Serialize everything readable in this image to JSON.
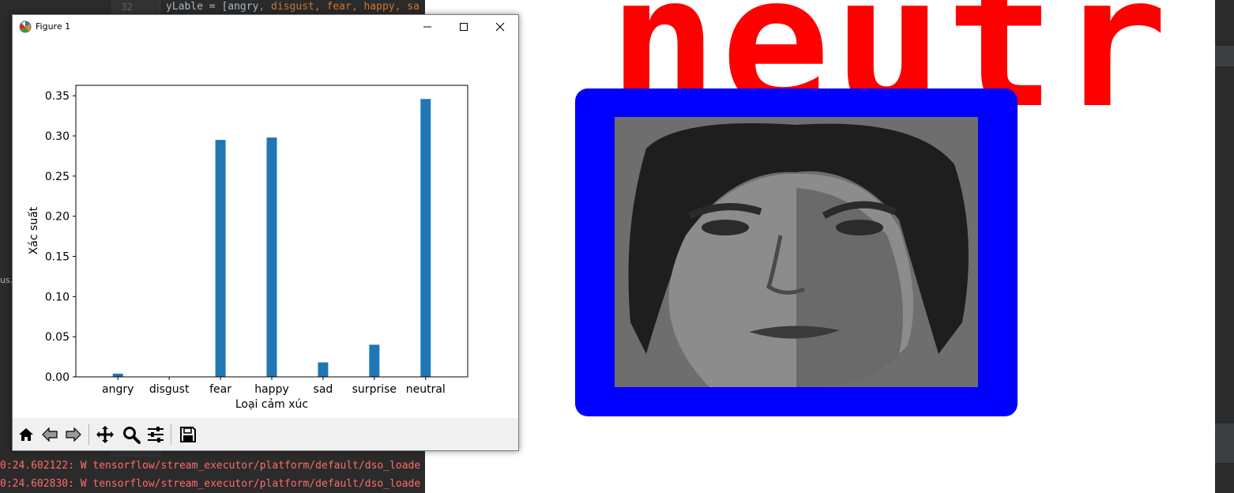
{
  "ide": {
    "line_number": "32",
    "code_line_prefix": "yLable = [angry",
    "code_line_parts": [
      ", disgust",
      ", fear",
      ", happy",
      ", sa"
    ],
    "side_fragment": "us.p",
    "console_lines": [
      "0:24.602122: W tensorflow/stream_executor/platform/default/dso_loade",
      "0:24.602830: W tensorflow/stream_executor/platform/default/dso_loade"
    ]
  },
  "figure": {
    "title": "Figure 1",
    "minimize_icon": "minimize-icon",
    "maximize_icon": "maximize-icon",
    "close_icon": "close-icon"
  },
  "toolbar": {
    "tools": [
      {
        "name": "home-icon"
      },
      {
        "name": "back-arrow-icon"
      },
      {
        "name": "forward-arrow-icon"
      },
      {
        "name": "pan-icon"
      },
      {
        "name": "zoom-icon"
      },
      {
        "name": "configure-subplots-icon"
      },
      {
        "name": "save-icon"
      }
    ]
  },
  "chart_data": {
    "type": "bar",
    "categories": [
      "angry",
      "disgust",
      "fear",
      "happy",
      "sad",
      "surprise",
      "neutral"
    ],
    "values": [
      0.004,
      0.0,
      0.295,
      0.298,
      0.018,
      0.04,
      0.346
    ],
    "title": "",
    "xlabel": "Loại cảm xúc",
    "ylabel": "Xác suất",
    "ylim": [
      0,
      0.363
    ],
    "yticks": [
      "0.00",
      "0.05",
      "0.10",
      "0.15",
      "0.20",
      "0.25",
      "0.30",
      "0.35"
    ],
    "bar_color": "#1f77b4",
    "grid": false
  },
  "cv_window": {
    "label": "neutr",
    "label_color": "#ff0000",
    "box_color": "#0000ff"
  }
}
